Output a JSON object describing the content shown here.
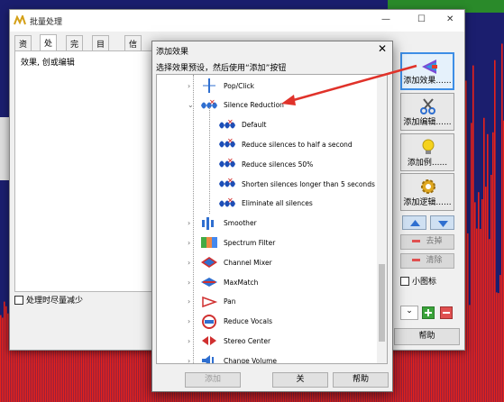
{
  "batch_window": {
    "title": "批量处理",
    "controls": {
      "minimize": "—",
      "maximize": "☐",
      "close": "✕"
    },
    "tabs": [
      {
        "label": "资源"
      },
      {
        "label": "处理"
      },
      {
        "label": "完成"
      },
      {
        "label": "目的地"
      },
      {
        "label": "信息"
      }
    ],
    "active_tab": "处理",
    "effect_chain_label": "效果, 创或编辑",
    "no_prompt_checkbox": "处理时尽量减少",
    "buttons": {
      "add_effect": "添加效果......",
      "add_edit": "添加编辑......",
      "add_condition": "添加例......",
      "add_logic": "添加逻辑......",
      "remove": "去掉",
      "clear": "清除",
      "small_icons": "小图标",
      "help": "帮助"
    }
  },
  "dialog": {
    "title": "添加效果",
    "close": "✕",
    "prompt": "选择效果预设，然后使用“添加”按钮",
    "tree": [
      {
        "label": "Pop/Click",
        "level": 0,
        "icon": "pop-click-icon",
        "expander": "›"
      },
      {
        "label": "Silence Reduction",
        "level": 0,
        "icon": "silence-reduction-icon",
        "expander": "⌄",
        "expanded": true
      },
      {
        "label": "Default",
        "level": 1,
        "icon": "silence-preset-icon"
      },
      {
        "label": "Reduce silences to half a second",
        "level": 1,
        "icon": "silence-preset-icon"
      },
      {
        "label": "Reduce silences 50%",
        "level": 1,
        "icon": "silence-preset-icon"
      },
      {
        "label": "Shorten silences longer than 5 seconds",
        "level": 1,
        "icon": "silence-preset-icon"
      },
      {
        "label": "Eliminate all silences",
        "level": 1,
        "icon": "silence-preset-icon"
      },
      {
        "label": "Smoother",
        "level": 0,
        "icon": "smoother-icon",
        "expander": "›"
      },
      {
        "label": "Spectrum Filter",
        "level": 0,
        "icon": "spectrum-filter-icon",
        "expander": "›"
      },
      {
        "label": "Channel Mixer",
        "level": 0,
        "icon": "channel-mixer-icon",
        "expander": "›"
      },
      {
        "label": "MaxMatch",
        "level": 0,
        "icon": "maxmatch-icon",
        "expander": "›"
      },
      {
        "label": "Pan",
        "level": 0,
        "icon": "pan-icon",
        "expander": "›"
      },
      {
        "label": "Reduce Vocals",
        "level": 0,
        "icon": "reduce-vocals-icon",
        "expander": "›"
      },
      {
        "label": "Stereo Center",
        "level": 0,
        "icon": "stereo-center-icon",
        "expander": "›"
      },
      {
        "label": "Change Volume",
        "level": 0,
        "icon": "change-volume-icon",
        "expander": "›"
      }
    ],
    "buttons": {
      "add": "添加",
      "close": "关",
      "help": "帮助"
    }
  },
  "colors": {
    "waveform_bg": "#1b1e6e",
    "waveform": "#e8221a",
    "arrow": "#e0322a",
    "selection_border": "#3d8ee6"
  }
}
